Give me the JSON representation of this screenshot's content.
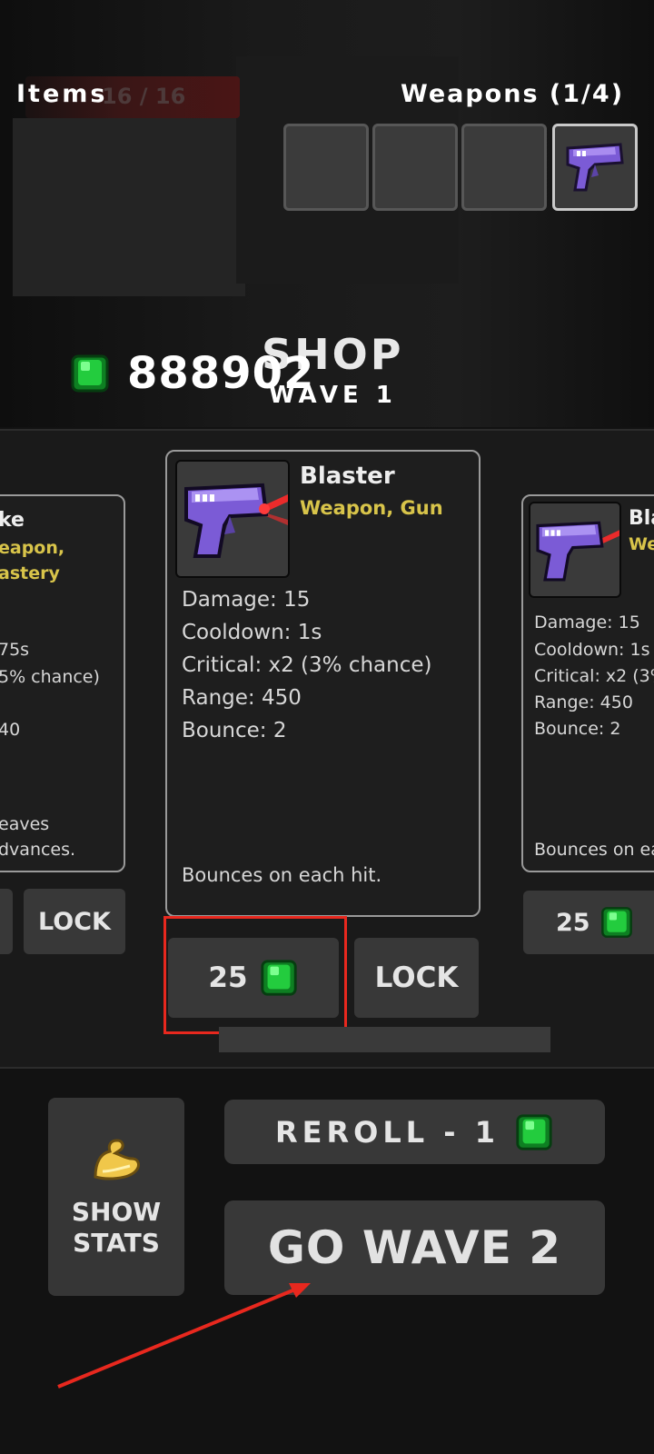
{
  "header": {
    "items_title": "Items",
    "items_count": "16 / 16",
    "weapons_title": "Weapons (1/4)"
  },
  "currency": {
    "amount": "888902",
    "icon": "green-gem-icon"
  },
  "shop": {
    "title": "SHOP",
    "wave": "WAVE 1"
  },
  "cards": {
    "left": {
      "name": "ke",
      "type_line1": "eapon,",
      "type_line2": "astery",
      "stats": [
        "75s",
        "5% chance)",
        "40"
      ],
      "desc_line1": "eaves",
      "desc_line2": "dvances.",
      "lock_label": "LOCK"
    },
    "center": {
      "name": "Blaster",
      "type": "Weapon, Gun",
      "stats": [
        "Damage: 15",
        "Cooldown: 1s",
        "Critical: x2 (3% chance)",
        "Range: 450",
        "Bounce: 2"
      ],
      "description": "Bounces on each hit.",
      "price": "25",
      "lock_label": "LOCK"
    },
    "right": {
      "name": "Bla",
      "type": "We",
      "stats": [
        "Damage: 15",
        "Cooldown: 1s",
        "Critical: x2 (3%",
        "Range: 450",
        "Bounce: 2"
      ],
      "description": "Bounces on eac",
      "price": "25"
    }
  },
  "controls": {
    "stats_line1": "SHOW",
    "stats_line2": "STATS",
    "reroll_label": "REROLL - 1",
    "go_label": "GO WAVE 2"
  },
  "colors": {
    "accent_yellow": "#d8c44a",
    "gem_green": "#22c93a",
    "annotation_red": "#e8281e",
    "weapon_purple": "#7b5bd6"
  }
}
